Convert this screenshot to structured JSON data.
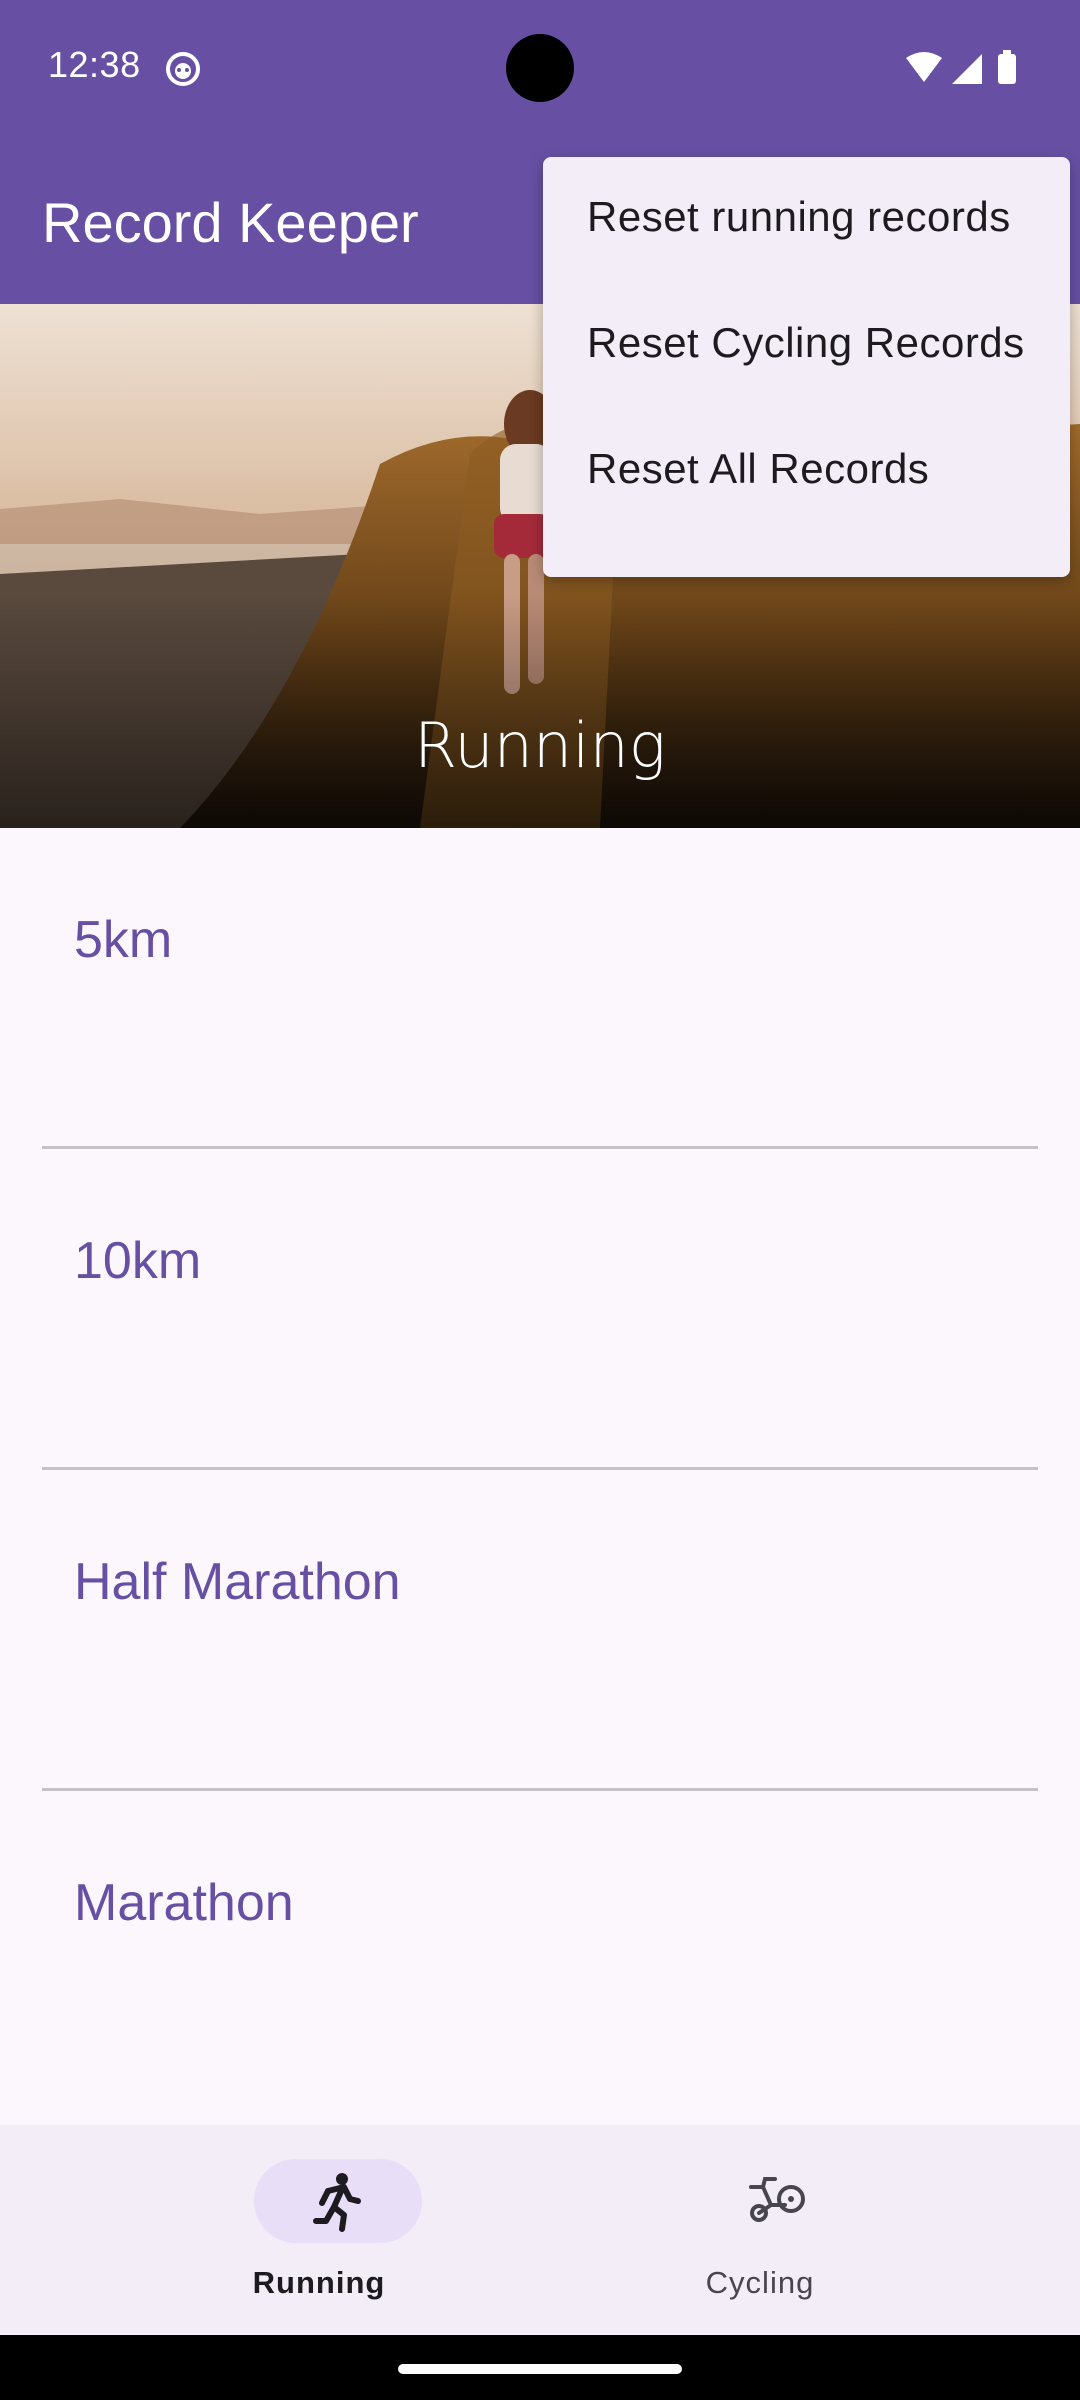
{
  "status_bar": {
    "time": "12:38",
    "icons": [
      "android-face-icon",
      "wifi-icon",
      "signal-icon",
      "battery-icon"
    ]
  },
  "app_bar": {
    "title": "Record Keeper"
  },
  "hero": {
    "title": "Running"
  },
  "records": [
    {
      "label": "5km"
    },
    {
      "label": "10km"
    },
    {
      "label": "Half Marathon"
    },
    {
      "label": "Marathon"
    }
  ],
  "bottom_nav": {
    "items": [
      {
        "label": "Running",
        "icon": "running-icon",
        "selected": true
      },
      {
        "label": "Cycling",
        "icon": "cycling-icon",
        "selected": false
      }
    ]
  },
  "overflow_menu": {
    "items": [
      {
        "label": "Reset running records"
      },
      {
        "label": "Reset Cycling Records"
      },
      {
        "label": "Reset All Records"
      }
    ]
  },
  "colors": {
    "primary": "#6750a4",
    "background": "#fcf7fc",
    "nav_background": "#f2edf6",
    "nav_pill": "#e8def8",
    "menu_background": "#f3edf7",
    "divider": "#c4c0c6"
  }
}
